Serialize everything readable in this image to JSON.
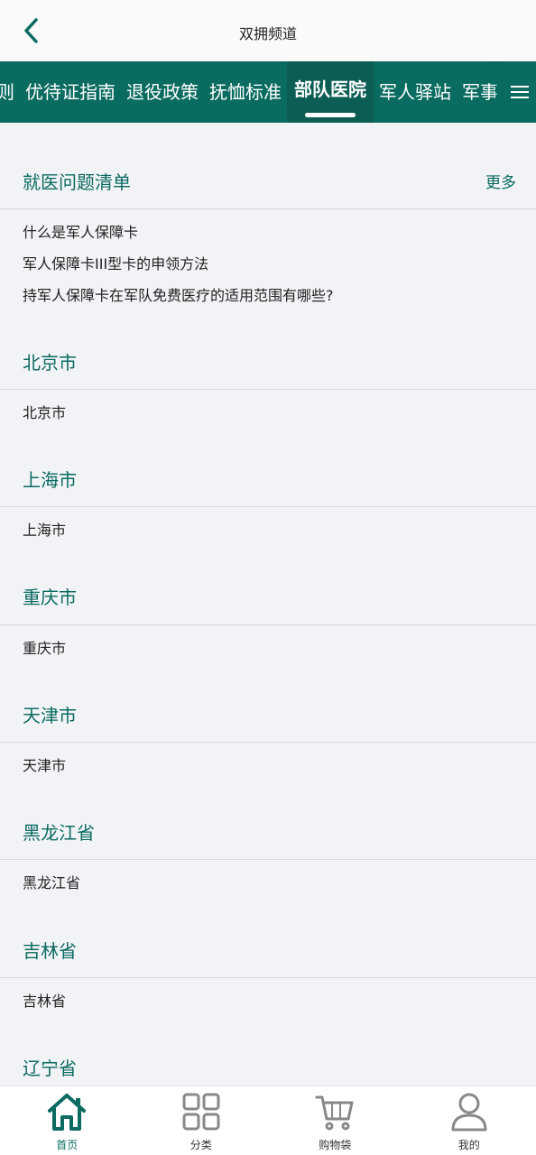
{
  "header": {
    "title": "双拥频道"
  },
  "tabs": [
    {
      "label": "则"
    },
    {
      "label": "优待证指南"
    },
    {
      "label": "退役政策"
    },
    {
      "label": "抚恤标准"
    },
    {
      "label": "部队医院"
    },
    {
      "label": "军人驿站"
    },
    {
      "label": "军事"
    }
  ],
  "faq": {
    "title": "就医问题清单",
    "more": "更多",
    "items": [
      "什么是军人保障卡",
      "军人保障卡III型卡的申领方法",
      "持军人保障卡在军队免费医疗的适用范围有哪些?"
    ]
  },
  "regions": [
    {
      "title": "北京市",
      "item": "北京市"
    },
    {
      "title": "上海市",
      "item": "上海市"
    },
    {
      "title": "重庆市",
      "item": "重庆市"
    },
    {
      "title": "天津市",
      "item": "天津市"
    },
    {
      "title": "黑龙江省",
      "item": "黑龙江省"
    },
    {
      "title": "吉林省",
      "item": "吉林省"
    },
    {
      "title": "辽宁省"
    }
  ],
  "bottom_nav": [
    {
      "label": "首页",
      "icon": "home-icon",
      "active": true
    },
    {
      "label": "分类",
      "icon": "grid-icon"
    },
    {
      "label": "购物袋",
      "icon": "cart-icon"
    },
    {
      "label": "我的",
      "icon": "user-icon"
    }
  ],
  "colors": {
    "brand": "#0a6b60",
    "background": "#f2f3f7"
  }
}
